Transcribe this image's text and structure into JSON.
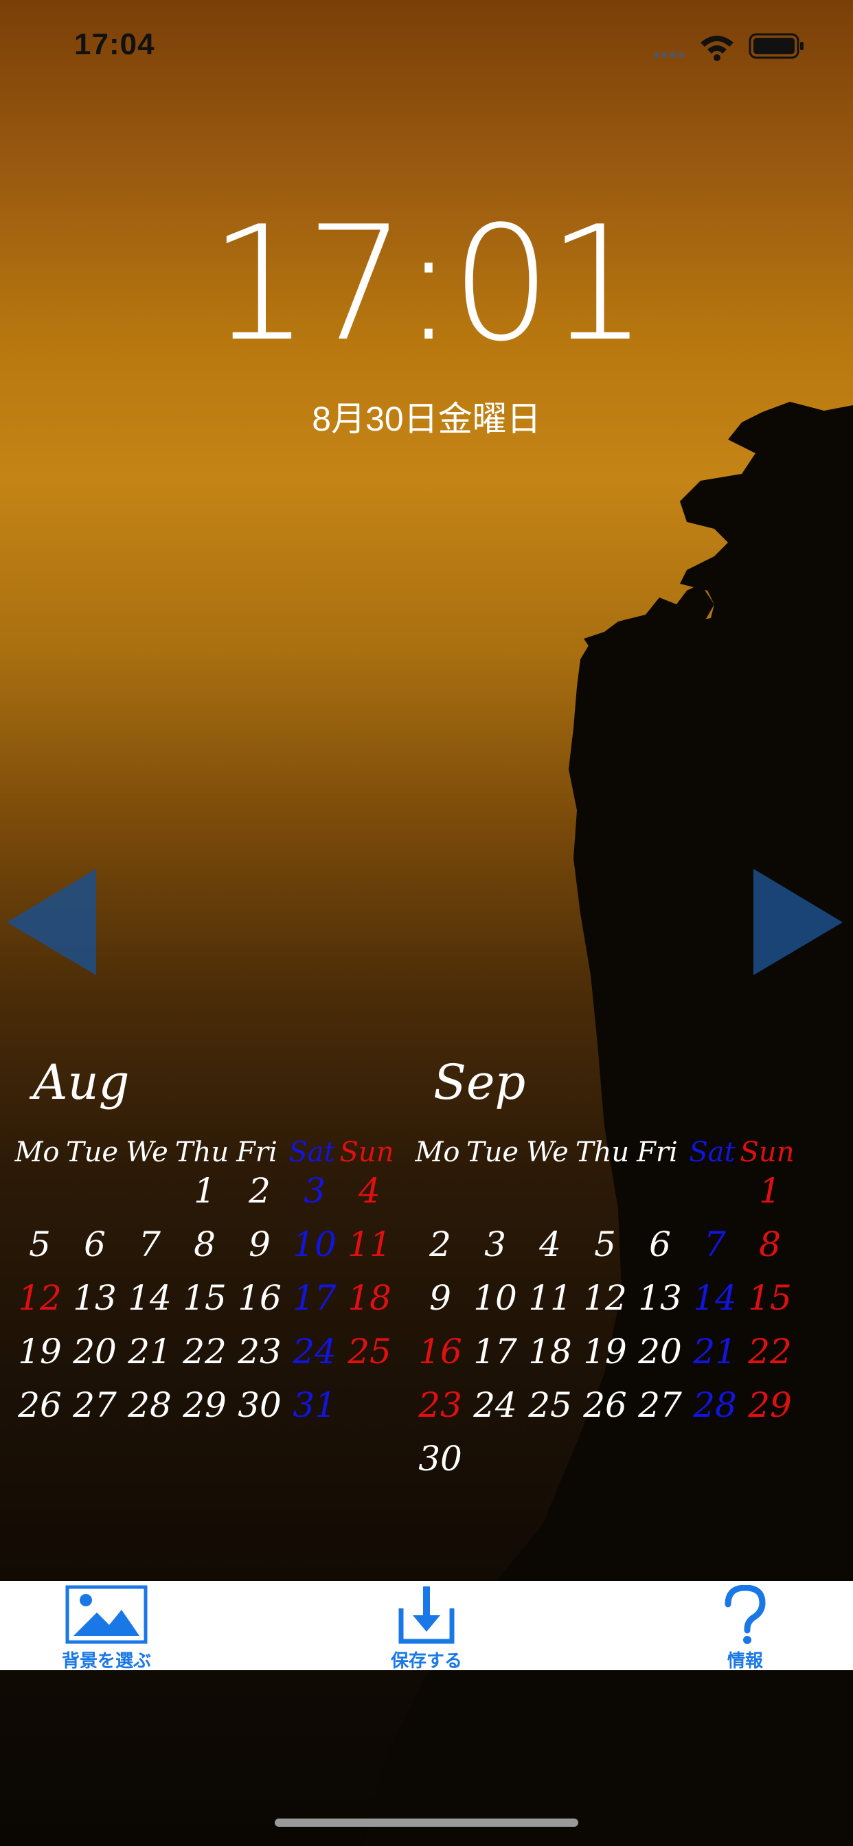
{
  "status_bar": {
    "time": "17:04"
  },
  "lock_screen": {
    "time": "17:01",
    "date": "8月30日金曜日"
  },
  "calendar": {
    "weekday_headers": [
      {
        "label": "Mo",
        "type": "wd"
      },
      {
        "label": "Tue",
        "type": "wd"
      },
      {
        "label": "We",
        "type": "wd"
      },
      {
        "label": "Thu",
        "type": "wd"
      },
      {
        "label": "Fri",
        "type": "wd"
      },
      {
        "label": "Sat",
        "type": "sat"
      },
      {
        "label": "Sun",
        "type": "sun"
      }
    ],
    "months": [
      {
        "name": "Aug",
        "weeks": [
          [
            "",
            "",
            "",
            "1",
            "2",
            "3",
            "4"
          ],
          [
            "5",
            "6",
            "7",
            "8",
            "9",
            "10",
            "11"
          ],
          [
            "12",
            "13",
            "14",
            "15",
            "16",
            "17",
            "18"
          ],
          [
            "19",
            "20",
            "21",
            "22",
            "23",
            "24",
            "25"
          ],
          [
            "26",
            "27",
            "28",
            "29",
            "30",
            "31",
            ""
          ]
        ],
        "holidays": [
          "12"
        ]
      },
      {
        "name": "Sep",
        "weeks": [
          [
            "",
            "",
            "",
            "",
            "",
            "",
            "1"
          ],
          [
            "2",
            "3",
            "4",
            "5",
            "6",
            "7",
            "8"
          ],
          [
            "9",
            "10",
            "11",
            "12",
            "13",
            "14",
            "15"
          ],
          [
            "16",
            "17",
            "18",
            "19",
            "20",
            "21",
            "22"
          ],
          [
            "23",
            "24",
            "25",
            "26",
            "27",
            "28",
            "29"
          ],
          [
            "30",
            "",
            "",
            "",
            "",
            "",
            ""
          ]
        ],
        "holidays": [
          "16",
          "23"
        ]
      }
    ]
  },
  "toolbar": {
    "choose_background": "背景を選ぶ",
    "save": "保存する",
    "info": "情報"
  },
  "colors": {
    "saturday": "#1214e0",
    "sunday": "#e01010",
    "toolbar_accent": "#1a78e6",
    "arrow": "#1c4f8a"
  }
}
